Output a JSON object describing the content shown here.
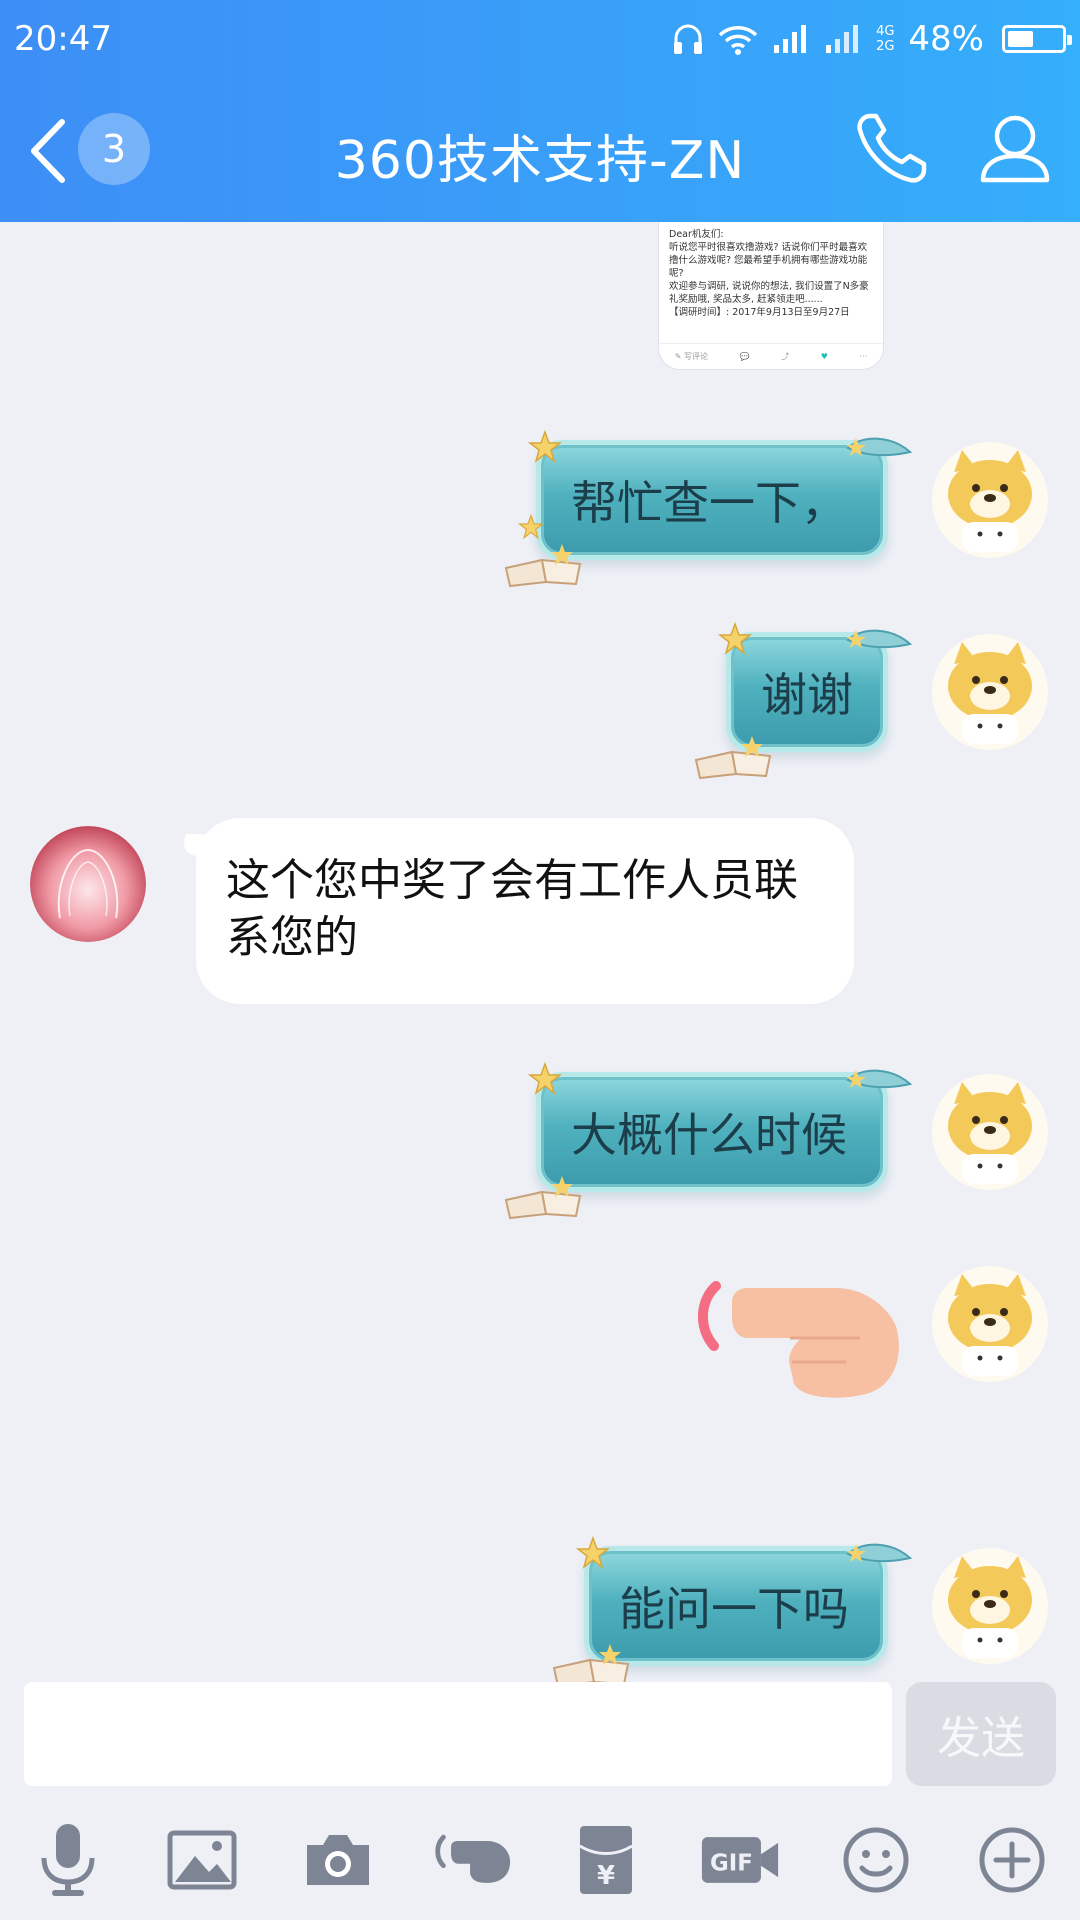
{
  "status_bar": {
    "time": "20:47",
    "network_top": "4G",
    "network_bottom": "2G",
    "battery_percent": "48%",
    "battery_level": 0.48
  },
  "header": {
    "unread_count": "3",
    "title": "360技术支持-ZN",
    "icons": [
      "back-icon",
      "phone-icon",
      "profile-icon"
    ]
  },
  "shared_card": {
    "text": "Dear机友们:\n听说您平时很喜欢撸游戏? 话说你们平时最喜欢撸什么游戏呢? 您最希望手机拥有哪些游戏功能呢?\n欢迎参与调研, 说说你的想法, 我们设置了N多豪礼奖励哦, 奖品太多, 赶紧领走吧......\n【调研时间】: 2017年9月13日至9月27日",
    "action_label": "写评论"
  },
  "messages": [
    {
      "side": "right",
      "text": "帮忙查一下，"
    },
    {
      "side": "right",
      "text": "谢谢"
    },
    {
      "side": "left",
      "text": "这个您中奖了会有工作人员联系您的"
    },
    {
      "side": "right",
      "text": "大概什么时候"
    },
    {
      "side": "right",
      "sticker": "pointing-hand"
    },
    {
      "side": "right",
      "text": "能问一下吗"
    }
  ],
  "input": {
    "value": "",
    "send_label": "发送"
  },
  "toolbar": {
    "icons": [
      "microphone-icon",
      "image-icon",
      "camera-icon",
      "poke-icon",
      "red-packet-icon",
      "gif-icon",
      "emoji-icon",
      "plus-icon"
    ],
    "gif_label": "GIF",
    "yen_symbol": "¥"
  },
  "colors": {
    "header_start": "#3d8ef6",
    "header_end": "#35aefb",
    "background": "#eef0f6",
    "bubble_teal": "#4fb1be",
    "send_disabled": "#d9dce3",
    "toolbar_icon": "#7d8494"
  }
}
